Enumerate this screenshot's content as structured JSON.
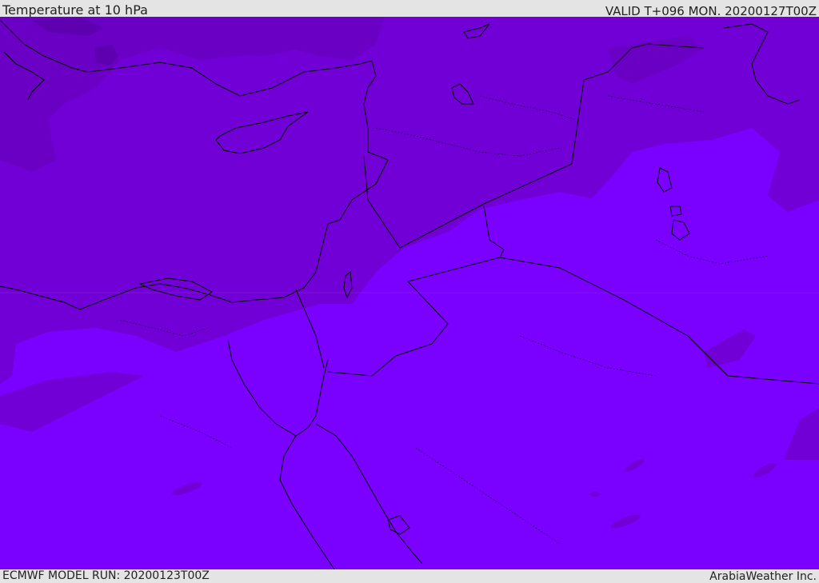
{
  "header": {
    "title": "Temperature at 10 hPa",
    "valid": "VALID T+096 MON. 20200127T00Z"
  },
  "footer": {
    "model_run": "ECMWF MODEL RUN: 20200123T00Z",
    "credit": "ArabiaWeather Inc."
  },
  "colors": {
    "cold_band": "#7100d6",
    "colder_band": "#7a00e8",
    "base": "#7a00ff",
    "coldest_patch": "#5f00b0",
    "coast": "#000000"
  }
}
